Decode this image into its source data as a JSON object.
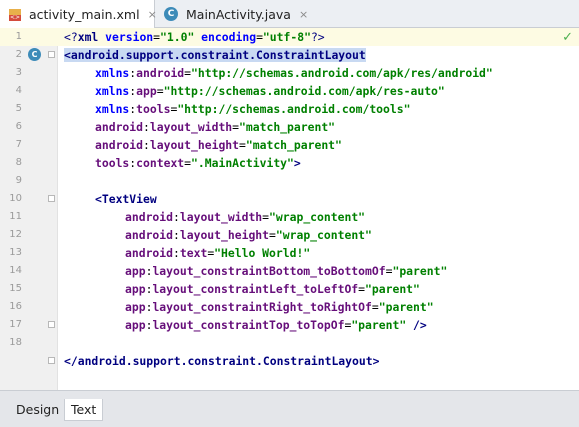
{
  "tabs": [
    {
      "label": "activity_main.xml",
      "icon": "xml-file-icon",
      "active": true
    },
    {
      "label": "MainActivity.java",
      "icon": "java-class-icon",
      "active": false
    }
  ],
  "tab_close_glyph": "×",
  "line_numbers": [
    "1",
    "2",
    "3",
    "4",
    "5",
    "6",
    "7",
    "8",
    "9",
    "10",
    "11",
    "12",
    "13",
    "14",
    "15",
    "16",
    "17",
    "18"
  ],
  "code": {
    "l1_decl_open": "<?",
    "l1_xml": "xml",
    "l1_a1": " version",
    "l1_eq1": "=",
    "l1_v1": "\"1.0\"",
    "l1_a2": " encoding",
    "l1_eq2": "=",
    "l1_v2": "\"utf-8\"",
    "l1_decl_close": "?>",
    "l2_tag": "<android.support.constraint.ConstraintLayout",
    "l3_ns": "xmlns",
    "l3_colon": ":",
    "l3_name": "android",
    "l3_value": "\"http://schemas.android.com/apk/res/android\"",
    "l4_ns": "xmlns",
    "l4_name": "app",
    "l4_value": "\"http://schemas.android.com/apk/res-auto\"",
    "l5_ns": "xmlns",
    "l5_name": "tools",
    "l5_value": "\"http://schemas.android.com/tools\"",
    "l6_ns": "android",
    "l6_name": "layout_width",
    "l6_value": "\"match_parent\"",
    "l7_ns": "android",
    "l7_name": "layout_height",
    "l7_value": "\"match_parent\"",
    "l8_ns": "tools",
    "l8_name": "context",
    "l8_value": "\".MainActivity\"",
    "l8_close": ">",
    "l10_tag": "<TextView",
    "l11_ns": "android",
    "l11_name": "layout_width",
    "l11_value": "\"wrap_content\"",
    "l12_ns": "android",
    "l12_name": "layout_height",
    "l12_value": "\"wrap_content\"",
    "l13_ns": "android",
    "l13_name": "text",
    "l13_value": "\"Hello World!\"",
    "l14_ns": "app",
    "l14_name": "layout_constraintBottom_toBottomOf",
    "l14_value": "\"parent\"",
    "l15_ns": "app",
    "l15_name": "layout_constraintLeft_toLeftOf",
    "l15_value": "\"parent\"",
    "l16_ns": "app",
    "l16_name": "layout_constraintRight_toRightOf",
    "l16_value": "\"parent\"",
    "l17_ns": "app",
    "l17_name": "layout_constraintTop_toTopOf",
    "l17_value": "\"parent\"",
    "l17_close": " />",
    "l19_tag": "</android.support.constraint.ConstraintLayout>"
  },
  "gutter_class_marker": "C",
  "bottom_tabs": [
    {
      "label": "Design",
      "active": false
    },
    {
      "label": "Text",
      "active": true
    }
  ]
}
